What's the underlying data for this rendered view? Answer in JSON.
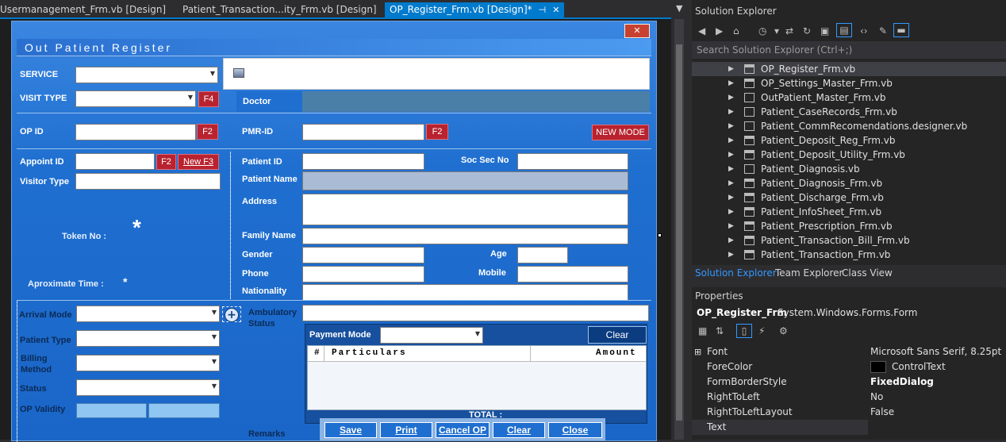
{
  "tabs": [
    {
      "label": "Usermanagement_Frm.vb [Design]"
    },
    {
      "label": "Patient_Transaction...ity_Frm.vb [Design]"
    },
    {
      "label": "OP_Register_Frm.vb [Design]*",
      "active": true
    }
  ],
  "form": {
    "title": "Out Patient  Register",
    "close_glyph": "✕",
    "labels": {
      "service": "SERVICE",
      "visit_type": "VISIT TYPE",
      "doctor": "Doctor",
      "op_id": "OP ID",
      "pmr_id": "PMR-ID",
      "appoint_id": "Appoint ID",
      "visitor_type": "Visitor Type",
      "token_no": "Token No :",
      "token_value": "*",
      "aprox_time": "Aproximate Time :",
      "aprox_value": "*",
      "patient_id": "Patient ID",
      "soc_sec_no": "Soc Sec No",
      "patient_name": "Patient Name",
      "address": "Address",
      "family_name": "Family Name",
      "gender": "Gender",
      "age": "Age",
      "phone": "Phone",
      "mobile": "Mobile",
      "nationality": "Nationality",
      "arrival_mode": "Arrival Mode",
      "ambulatory": "Ambulatory",
      "status_word": "Status",
      "patient_type": "Patient Type",
      "billing": "Billing",
      "method": "Method",
      "status": "Status",
      "op_validity": "OP Validity",
      "remarks": "Remarks",
      "payment_mode": "Payment Mode",
      "total": "TOTAL :"
    },
    "buttons": {
      "f4": "F4",
      "f2_op": "F2",
      "f2_pmr": "F2",
      "new_mode": "NEW MODE",
      "f2_appoint": "F2",
      "new_f3": "New F3",
      "plus": "+",
      "clear_payment": "Clear",
      "save": "Save",
      "print": "Print",
      "cancel_op": "Cancel OP",
      "clear": "Clear",
      "close": "Close"
    },
    "grid_headers": {
      "num": "#",
      "particulars": "Particulars",
      "amount": "Amount"
    }
  },
  "solution_explorer": {
    "title": "Solution Explorer",
    "search_placeholder": "Search Solution Explorer (Ctrl+;)",
    "items": [
      {
        "name": "OP_Register_Frm.vb",
        "form": true,
        "selected": true
      },
      {
        "name": "OP_Settings_Master_Frm.vb",
        "form": true
      },
      {
        "name": "OutPatient_Master_Frm.vb",
        "form": false
      },
      {
        "name": "Patient_CaseRecords_Frm.vb",
        "form": false
      },
      {
        "name": "Patient_CommRecomendations.designer.vb",
        "form": false
      },
      {
        "name": "Patient_Deposit_Reg_Frm.vb",
        "form": true
      },
      {
        "name": "Patient_Deposit_Utility_Frm.vb",
        "form": true
      },
      {
        "name": "Patient_Diagnosis.vb",
        "form": false
      },
      {
        "name": "Patient_Diagnosis_Frm.vb",
        "form": true
      },
      {
        "name": "Patient_Discharge_Frm.vb",
        "form": true
      },
      {
        "name": "Patient_InfoSheet_Frm.vb",
        "form": true
      },
      {
        "name": "Patient_Prescription_Frm.vb",
        "form": true
      },
      {
        "name": "Patient_Transaction_Bill_Frm.vb",
        "form": true
      },
      {
        "name": "Patient_Transaction_Frm.vb",
        "form": true
      }
    ],
    "bottom_tabs": [
      "Solution Explorer",
      "Team Explorer",
      "Class View"
    ]
  },
  "properties": {
    "title": "Properties",
    "object_name": "OP_Register_Frm",
    "object_type": "System.Windows.Forms.Form",
    "rows": [
      {
        "name": "Font",
        "value": "Microsoft Sans Serif, 8.25pt",
        "expand": "⊞"
      },
      {
        "name": "ForeColor",
        "value": "ControlText",
        "swatch": "#000000"
      },
      {
        "name": "FormBorderStyle",
        "value": "FixedDialog",
        "bold": true
      },
      {
        "name": "RightToLeft",
        "value": "No"
      },
      {
        "name": "RightToLeftLayout",
        "value": "False"
      },
      {
        "name": "Text",
        "value": ""
      }
    ]
  },
  "colors": {
    "accent": "#007acc",
    "form_blue": "#1f6fd0",
    "red_button": "#b8232f"
  }
}
